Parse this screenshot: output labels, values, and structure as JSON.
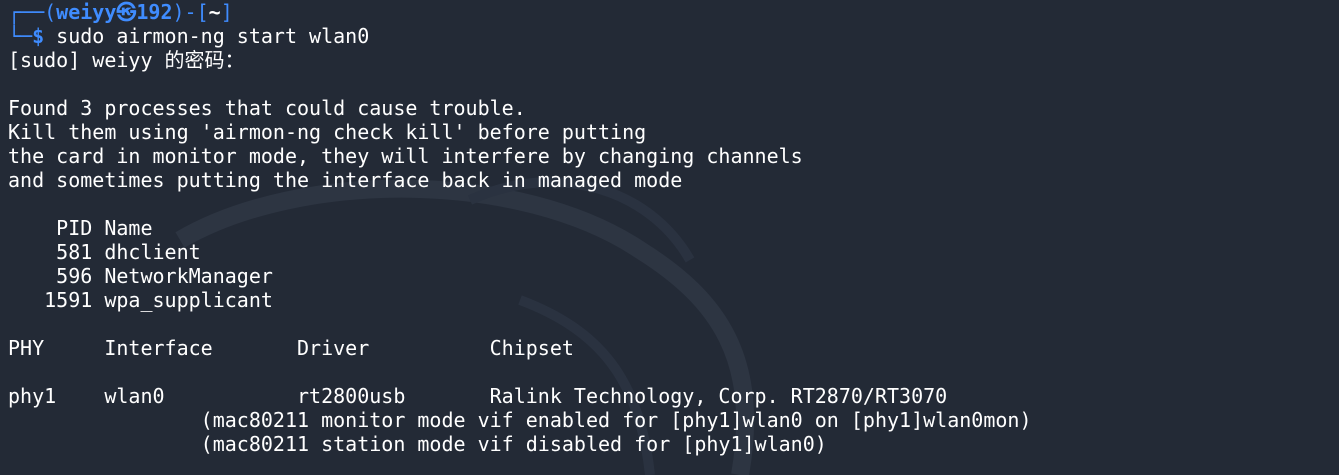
{
  "prompt": {
    "corner_top": "┌──(",
    "user": "weiyy",
    "at_symbol": "㉿",
    "host": "192",
    "mid": ")-[",
    "cwd": "~",
    "close": "]",
    "corner_bottom": "└─",
    "dollar": "$",
    "command": " sudo airmon-ng start wlan0"
  },
  "sudo_prompt": "[sudo] weiyy 的密码：",
  "warning_lines": [
    "Found 3 processes that could cause trouble.",
    "Kill them using 'airmon-ng check kill' before putting",
    "the card in monitor mode, they will interfere by changing channels",
    "and sometimes putting the interface back in managed mode"
  ],
  "process_table": {
    "header": "    PID Name",
    "rows": [
      "    581 dhclient",
      "    596 NetworkManager",
      "   1591 wpa_supplicant"
    ]
  },
  "interface_table": {
    "header": "PHY     Interface       Driver          Chipset",
    "row": "phy1    wlan0           rt2800usb       Ralink Technology, Corp. RT2870/RT3070",
    "notes": [
      "                (mac80211 monitor mode vif enabled for [phy1]wlan0 on [phy1]wlan0mon)",
      "                (mac80211 station mode vif disabled for [phy1]wlan0)"
    ]
  },
  "colors": {
    "background": "#232a36",
    "prompt_blue": "#3f8cff",
    "text": "#ffffff"
  }
}
